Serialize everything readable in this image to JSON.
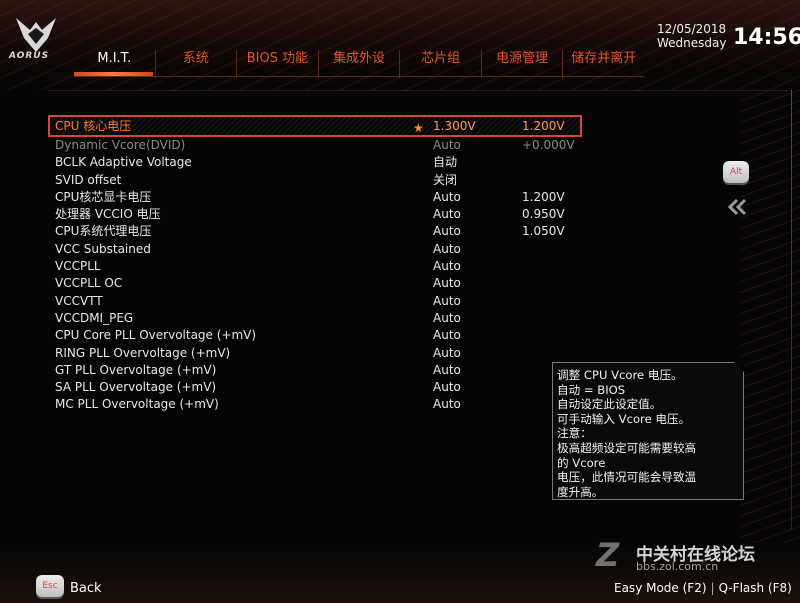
{
  "brand": {
    "logo_text": "AORUS"
  },
  "tabs": [
    {
      "label": "M.I.T.",
      "active": true
    },
    {
      "label": "系统",
      "active": false
    },
    {
      "label": "BIOS 功能",
      "active": false
    },
    {
      "label": "集成外设",
      "active": false
    },
    {
      "label": "芯片组",
      "active": false
    },
    {
      "label": "电源管理",
      "active": false
    },
    {
      "label": "储存并离开",
      "active": false
    }
  ],
  "clock": {
    "date": "12/05/2018",
    "weekday": "Wednesday",
    "time": "14:56"
  },
  "settings": [
    {
      "label": "CPU 核心电压",
      "value": "1.300V",
      "current": "1.200V",
      "selected": true,
      "starred": true
    },
    {
      "label": "Dynamic Vcore(DVID)",
      "value": "Auto",
      "current": "+0.000V",
      "disabled": true
    },
    {
      "label": "BCLK Adaptive Voltage",
      "value": "自动",
      "current": ""
    },
    {
      "label": "SVID offset",
      "value": "关闭",
      "current": ""
    },
    {
      "label": "CPU核芯显卡电压",
      "value": "Auto",
      "current": "1.200V"
    },
    {
      "label": "处理器 VCCIO 电压",
      "value": "Auto",
      "current": "0.950V"
    },
    {
      "label": "CPU系统代理电压",
      "value": "Auto",
      "current": "1.050V"
    },
    {
      "label": "VCC Substained",
      "value": "Auto",
      "current": ""
    },
    {
      "label": "VCCPLL",
      "value": "Auto",
      "current": ""
    },
    {
      "label": "VCCPLL OC",
      "value": "Auto",
      "current": ""
    },
    {
      "label": "VCCVTT",
      "value": "Auto",
      "current": ""
    },
    {
      "label": "VCCDMI_PEG",
      "value": "Auto",
      "current": ""
    },
    {
      "label": "CPU Core PLL Overvoltage (+mV)",
      "value": "Auto",
      "current": ""
    },
    {
      "label": "RING PLL Overvoltage (+mV)",
      "value": "Auto",
      "current": ""
    },
    {
      "label": "GT PLL Overvoltage (+mV)",
      "value": "Auto",
      "current": ""
    },
    {
      "label": "SA PLL Overvoltage (+mV)",
      "value": "Auto",
      "current": ""
    },
    {
      "label": "MC PLL Overvoltage (+mV)",
      "value": "Auto",
      "current": ""
    }
  ],
  "side": {
    "alt_label": "Alt"
  },
  "help": {
    "lines": [
      "调整 CPU Vcore 电压。",
      "自动 = BIOS",
      "自动设定此设定值。",
      "可手动输入 Vcore 电压。",
      "注意：",
      "极高超频设定可能需要较高",
      "的 Vcore",
      "电压，此情况可能会导致温",
      "度升高。"
    ]
  },
  "footer": {
    "esc_label": "Esc",
    "back_label": "Back",
    "easy_mode": "Easy Mode (F2)",
    "separator": "|",
    "qflash": "Q-Flash (F8)"
  },
  "watermark": {
    "letter": "Z",
    "cn": "中关村在线论坛",
    "url": "bbs.zol.com.cn"
  },
  "colors": {
    "accent": "#e0552e",
    "highlight_border": "#d4463a",
    "star": "#ff8a2a"
  }
}
